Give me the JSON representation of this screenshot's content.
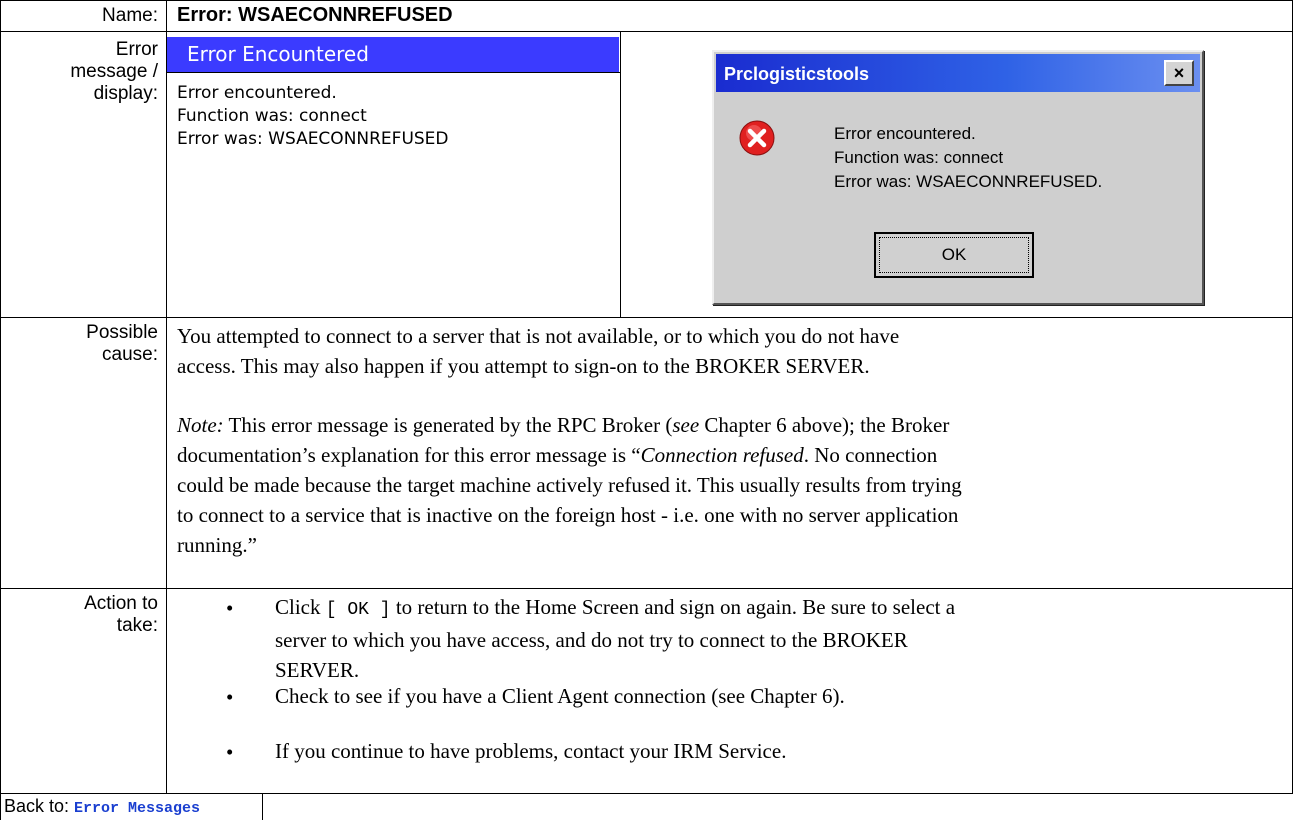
{
  "header": {
    "name_label": "Name:",
    "title": "Error:  WSAECONNREFUSED"
  },
  "error_row": {
    "label_line1": "Error",
    "label_line2": "message /",
    "label_line3": "display:",
    "bar_title": "Error Encountered",
    "msg_line1": "Error encountered.",
    "msg_line2": "Function was: connect",
    "msg_line3": "Error was: WSAECONNREFUSED"
  },
  "dialog": {
    "title": "Prclogisticstools",
    "close_glyph": "×",
    "msg_line1": "Error encountered.",
    "msg_line2": "Function was: connect",
    "msg_line3": "Error was: WSAECONNREFUSED.",
    "ok_label": "OK",
    "icon": "error-icon",
    "icon_color": "#e02020"
  },
  "cause_row": {
    "label_line1": "Possible",
    "label_line2": "cause:",
    "para1_line1": "You attempted to connect to a server that is not available, or to which you do not have",
    "para1_line2": "access. This may also happen if you attempt to sign-on to the BROKER SERVER.",
    "note_label": "Note:",
    "note_l1_a": " This error message is generated by the RPC Broker (",
    "note_l1_see": "see",
    "note_l1_b": " Chapter 6 above); the Broker",
    "note_l2_a": "documentation’s explanation for this error message is “",
    "note_l2_italic": "Connection refused",
    "note_l2_b": ". No connection",
    "note_l3": "could be made because the target machine actively refused it. This usually results from trying",
    "note_l4": "to connect to a service that is inactive on the foreign host - i.e. one with no server application",
    "note_l5": "running.”"
  },
  "action_row": {
    "label_line1": "Action to",
    "label_line2": "take:",
    "bullet_glyph": "•",
    "b1_a": "Click ",
    "b1_code": "[ OK ]",
    "b1_b": " to return to the Home Screen and sign on again.  Be sure to select a",
    "b1_l2": "server to which you have access, and do not try to connect to the BROKER",
    "b1_l3": "SERVER.",
    "b2": "Check to see if you have a Client Agent connection (see Chapter 6).",
    "b3": "If you continue to have problems, contact your IRM Service."
  },
  "footer": {
    "back_label": "Back to: ",
    "back_link": "Error Messages"
  }
}
